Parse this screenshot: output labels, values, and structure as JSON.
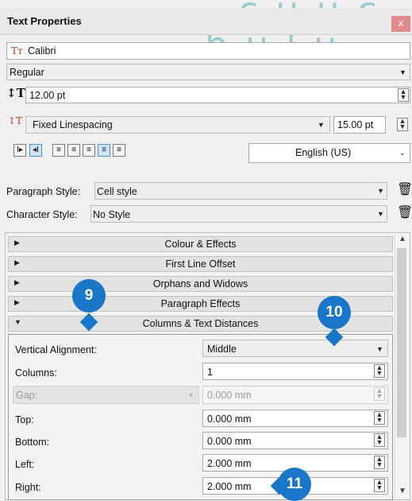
{
  "window": {
    "title": "Text Properties",
    "close_symbol": "x"
  },
  "watermark": {
    "line1": "cuuc",
    "line2": "hülu"
  },
  "font": {
    "family": "Calibri",
    "style": "Regular",
    "size": "12.00 pt"
  },
  "spacing": {
    "mode": "Fixed Linespacing",
    "value": "15.00 pt"
  },
  "language": "English (US)",
  "paragraph_style": {
    "label": "Paragraph Style:",
    "value": "Cell style"
  },
  "character_style": {
    "label": "Character Style:",
    "value": "No Style"
  },
  "sections": [
    {
      "label": "Colour & Effects"
    },
    {
      "label": "First Line Offset"
    },
    {
      "label": "Orphans and Widows"
    },
    {
      "label": "Paragraph Effects"
    },
    {
      "label": "Columns & Text Distances"
    }
  ],
  "columns_text": {
    "vertical_alignment": {
      "label": "Vertical Alignment:",
      "value": "Middle"
    },
    "columns": {
      "label": "Columns:",
      "value": "1"
    },
    "gap": {
      "label": "Gap:",
      "value": "0.000 mm"
    },
    "top": {
      "label": "Top:",
      "value": "0.000 mm"
    },
    "bottom": {
      "label": "Bottom:",
      "value": "0.000 mm"
    },
    "left": {
      "label": "Left:",
      "value": "2.000 mm"
    },
    "right": {
      "label": "Right:",
      "value": "2.000 mm"
    }
  },
  "callouts": {
    "c9": "9",
    "c10": "10",
    "c11": "11"
  },
  "colors": {
    "callout": "#1976c9",
    "close": "#e08b8b"
  }
}
